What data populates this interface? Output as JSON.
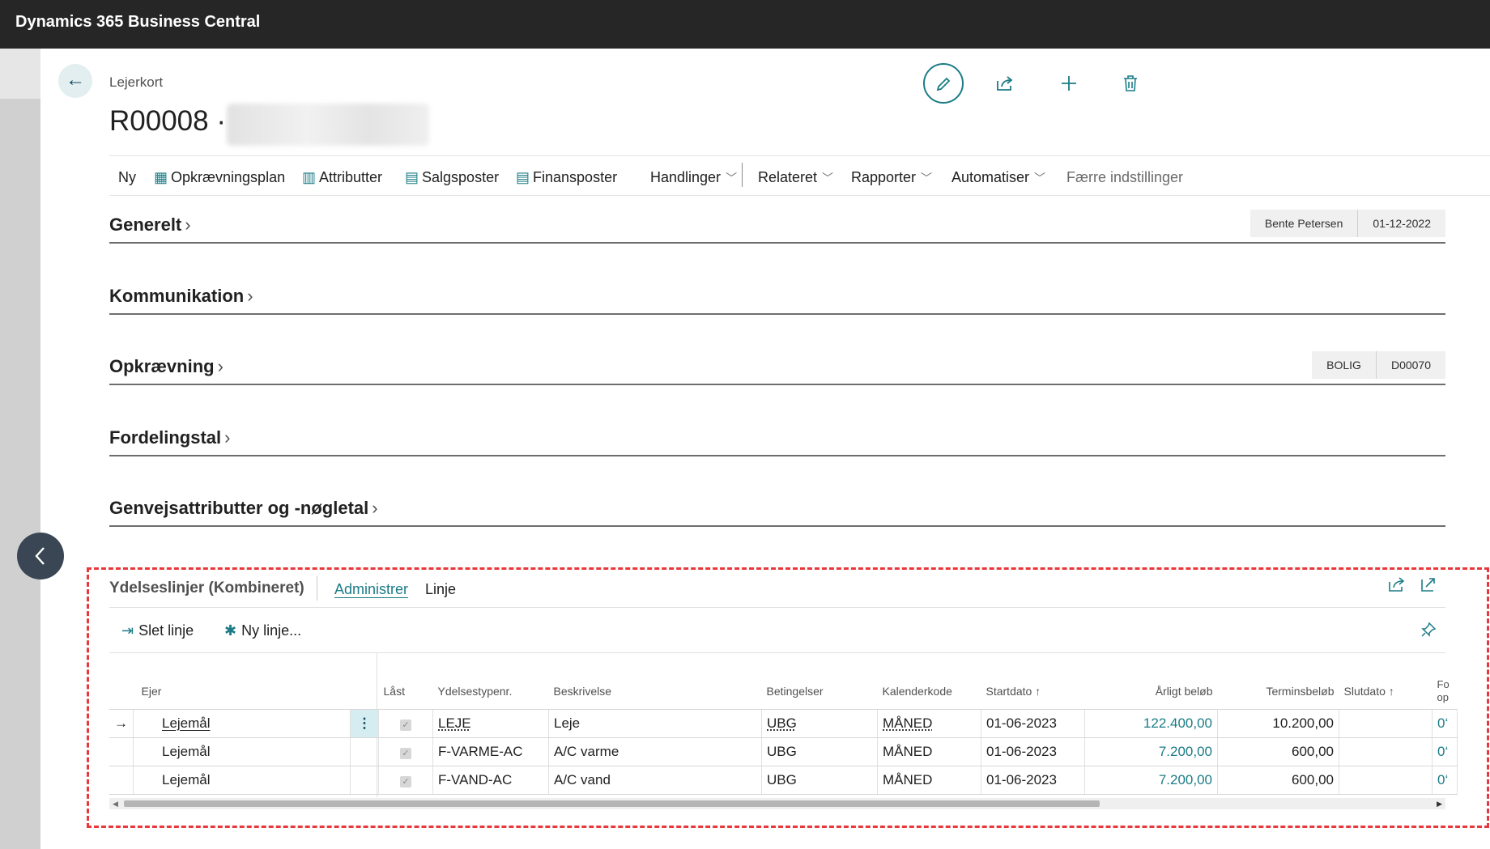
{
  "app": {
    "title": "Dynamics 365 Business Central"
  },
  "header": {
    "breadcrumb": "Lejerkort",
    "record_title": "R00008 ·",
    "icons": [
      "edit-icon",
      "share-icon",
      "plus-icon",
      "delete-icon"
    ]
  },
  "actions": {
    "items": [
      {
        "label": "Ny",
        "icon": ""
      },
      {
        "label": "Opkrævningsplan",
        "icon": "table-icon"
      },
      {
        "label": "Attributter",
        "icon": "grid-icon"
      },
      {
        "label": "Salgsposter",
        "icon": "ledger-icon"
      },
      {
        "label": "Finansposter",
        "icon": "ledger-icon"
      }
    ],
    "menus": [
      "Handlinger",
      "Relateret",
      "Rapporter",
      "Automatiser"
    ],
    "fewer": "Færre indstillinger"
  },
  "sections": [
    {
      "title": "Generelt",
      "pills": [
        "Bente Petersen",
        "01-12-2022"
      ]
    },
    {
      "title": "Kommunikation",
      "pills": []
    },
    {
      "title": "Opkrævning",
      "pills": [
        "BOLIG",
        "D00070"
      ]
    },
    {
      "title": "Fordelingstal",
      "pills": []
    },
    {
      "title": "Genvejsattributter og -nøgletal",
      "pills": []
    }
  ],
  "subpage": {
    "title": "Ydelseslinjer (Kombineret)",
    "tabs": [
      "Administrer",
      "Linje"
    ],
    "actions": {
      "delete_line": "Slet linje",
      "new_line": "Ny linje..."
    },
    "columns": {
      "owner": "Ejer",
      "locked": "Låst",
      "type_no": "Ydelsestypenr.",
      "description": "Beskrivelse",
      "terms": "Betingelser",
      "calendar": "Kalenderkode",
      "start": "Startdato",
      "annual": "Årligt beløb",
      "term_amount": "Terminsbeløb",
      "end": "Slutdato",
      "cut1": "Fo",
      "cut2": "op"
    },
    "rows": [
      {
        "owner": "Lejemål",
        "locked": true,
        "type_no": "LEJE",
        "description": "Leje",
        "terms": "UBG",
        "calendar": "MÅNED",
        "start": "01-06-2023",
        "annual": "122.400,00",
        "term_amount": "10.200,00",
        "end": "",
        "cut": "0‘"
      },
      {
        "owner": "Lejemål",
        "locked": true,
        "type_no": "F-VARME-AC",
        "description": "A/C varme",
        "terms": "UBG",
        "calendar": "MÅNED",
        "start": "01-06-2023",
        "annual": "7.200,00",
        "term_amount": "600,00",
        "end": "",
        "cut": "0‘"
      },
      {
        "owner": "Lejemål",
        "locked": true,
        "type_no": "F-VAND-AC",
        "description": "A/C vand",
        "terms": "UBG",
        "calendar": "MÅNED",
        "start": "01-06-2023",
        "annual": "7.200,00",
        "term_amount": "600,00",
        "end": "",
        "cut": "0‘"
      }
    ]
  },
  "colors": {
    "accent": "#1b7c86",
    "topbar": "#262626",
    "highlight_border": "#e8383b"
  }
}
